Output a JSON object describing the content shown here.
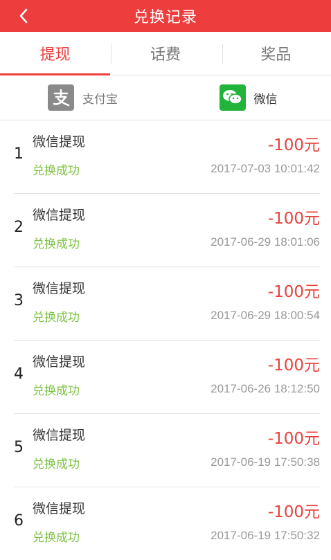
{
  "header": {
    "title": "兑换记录"
  },
  "tabs": [
    {
      "label": "提现",
      "active": true
    },
    {
      "label": "话费",
      "active": false
    },
    {
      "label": "奖品",
      "active": false
    }
  ],
  "pay_methods": {
    "alipay": {
      "label": "支付宝",
      "icon": "alipay-icon"
    },
    "wechat": {
      "label": "微信",
      "icon": "wechat-icon"
    }
  },
  "records": [
    {
      "index": "1",
      "name": "微信提现",
      "status": "兑换成功",
      "amount": "-100元",
      "time": "2017-07-03 10:01:42"
    },
    {
      "index": "2",
      "name": "微信提现",
      "status": "兑换成功",
      "amount": "-100元",
      "time": "2017-06-29 18:01:06"
    },
    {
      "index": "3",
      "name": "微信提现",
      "status": "兑换成功",
      "amount": "-100元",
      "time": "2017-06-29 18:00:54"
    },
    {
      "index": "4",
      "name": "微信提现",
      "status": "兑换成功",
      "amount": "-100元",
      "time": "2017-06-26 18:12:50"
    },
    {
      "index": "5",
      "name": "微信提现",
      "status": "兑换成功",
      "amount": "-100元",
      "time": "2017-06-19 17:50:38"
    },
    {
      "index": "6",
      "name": "微信提现",
      "status": "兑换成功",
      "amount": "-100元",
      "time": "2017-06-19 17:50:32"
    }
  ],
  "colors": {
    "accent": "#ee3d3d",
    "success": "#7cc242",
    "amount": "#e8413c"
  }
}
